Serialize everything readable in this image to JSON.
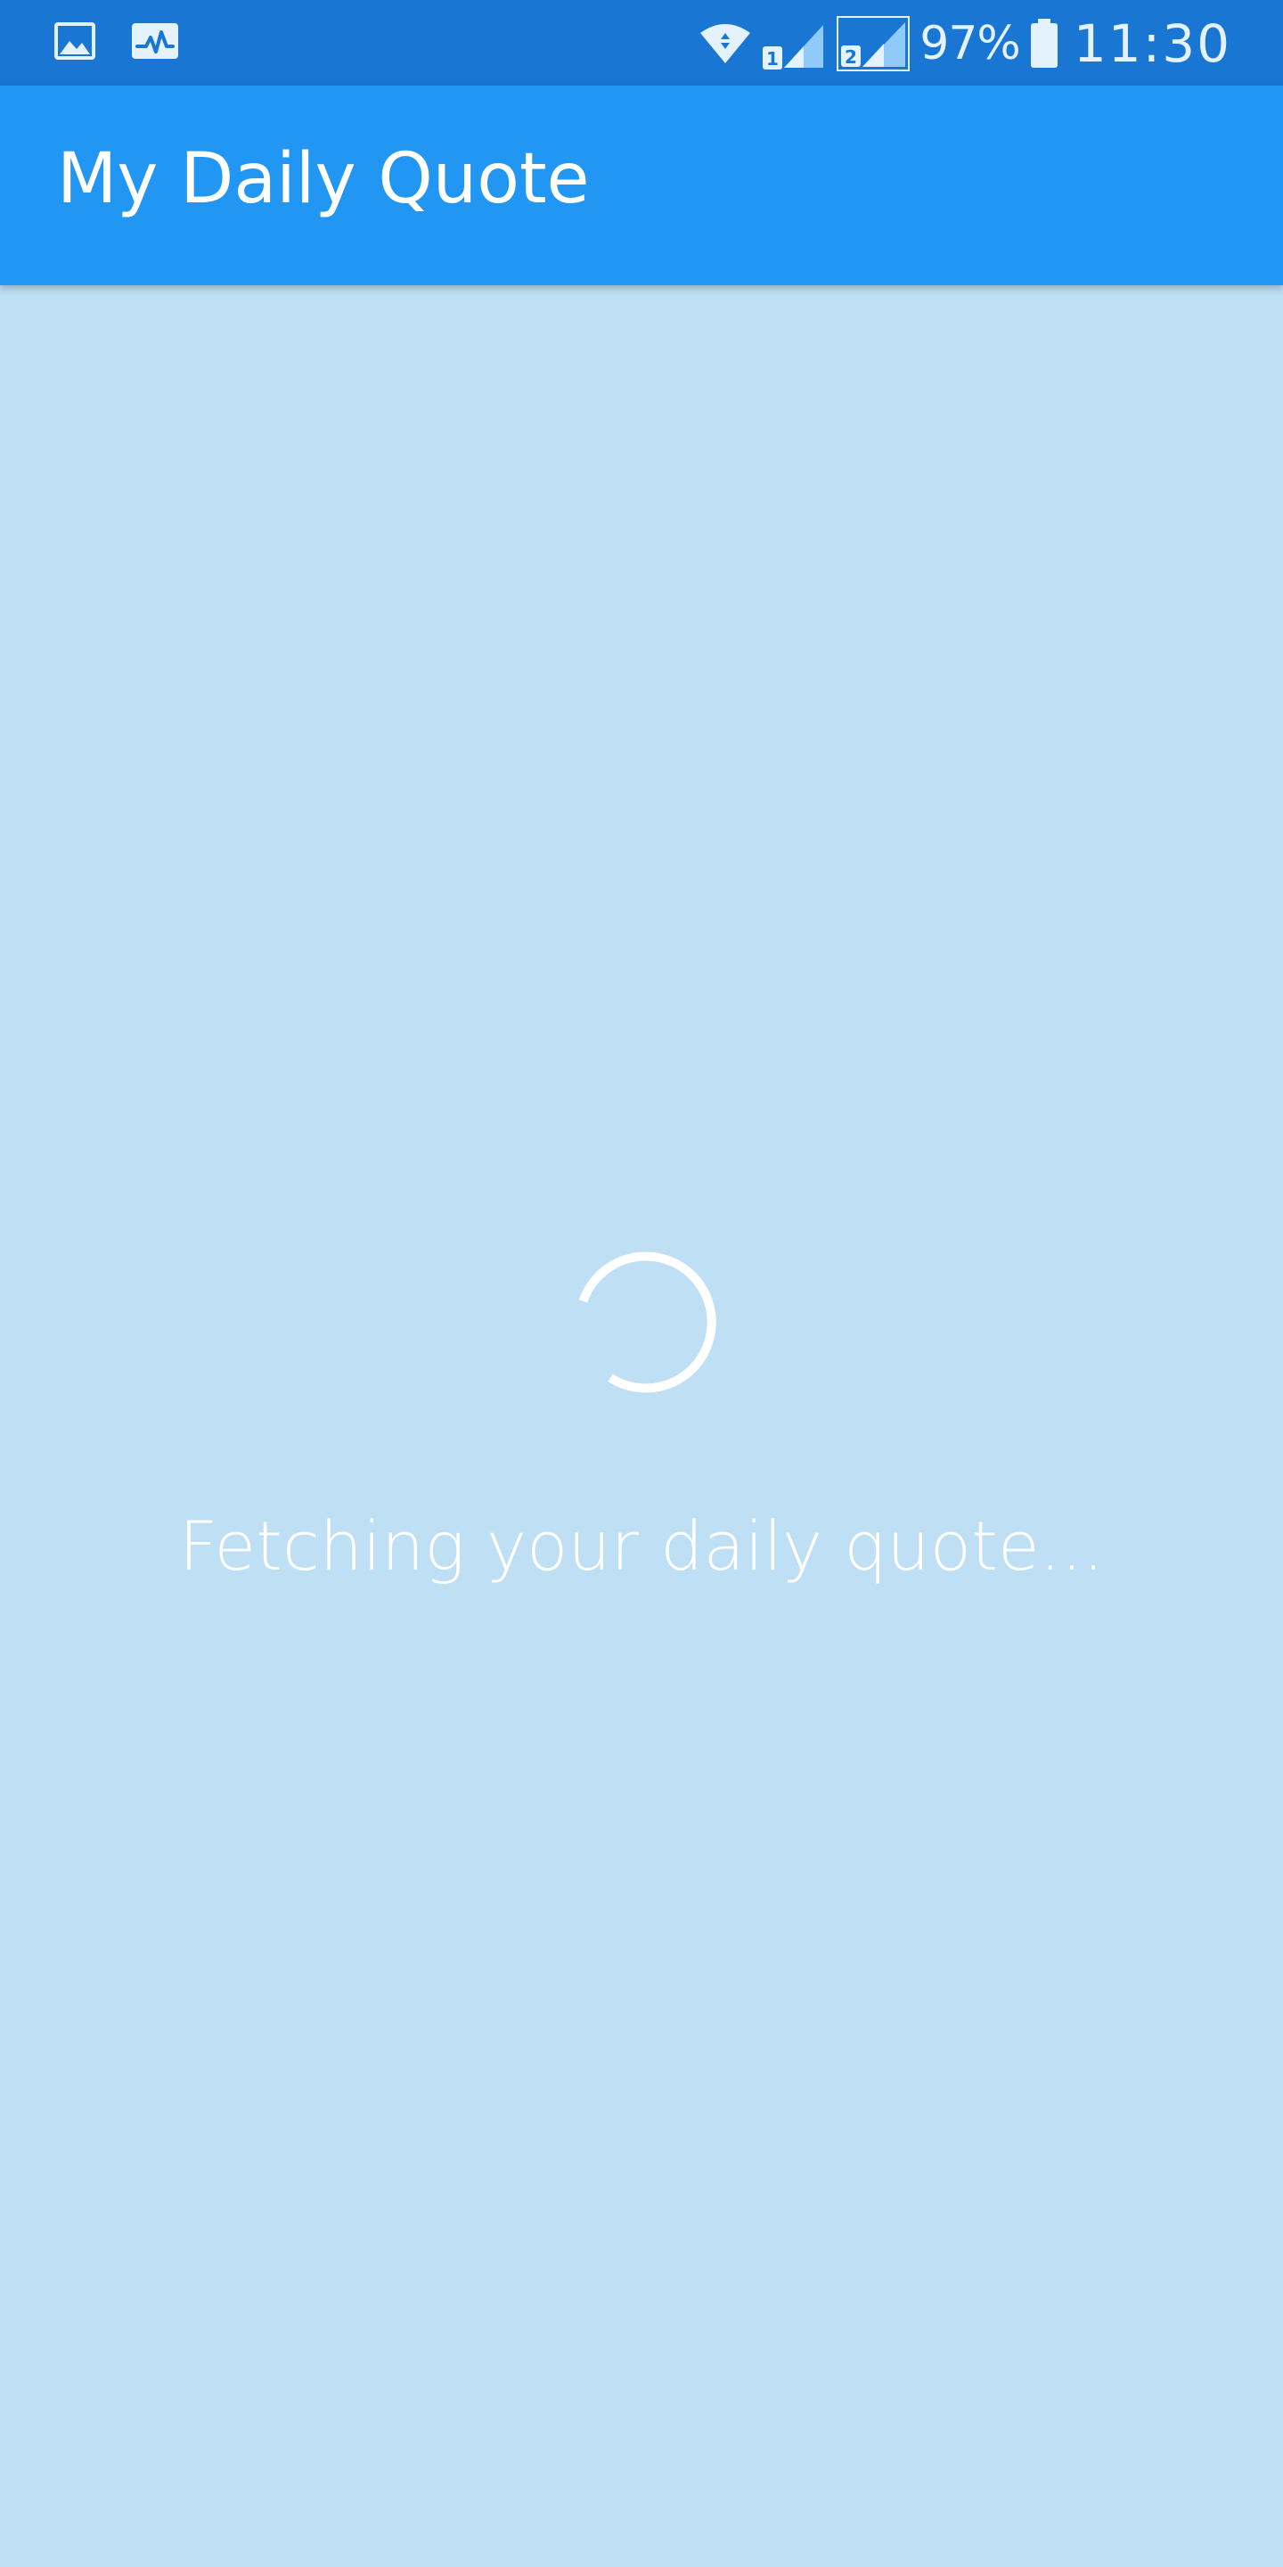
{
  "status_bar": {
    "left_icons": [
      "image-icon",
      "activity-icon"
    ],
    "right_icons": [
      "wifi-icon",
      "sim1-signal-icon",
      "sim2-signal-icon",
      "battery-icon"
    ],
    "sim1_label": "1",
    "sim2_label": "2",
    "battery_percent": "97%",
    "time": "11:30"
  },
  "app_bar": {
    "title": "My Daily Quote"
  },
  "content": {
    "loading_text": "Fetching your daily quote...",
    "spinner_icon": "progress-spinner-icon"
  },
  "colors": {
    "status_bar": "#1976d2",
    "app_bar": "#2196f3",
    "background": "#bedff4",
    "text": "#ffffff"
  }
}
